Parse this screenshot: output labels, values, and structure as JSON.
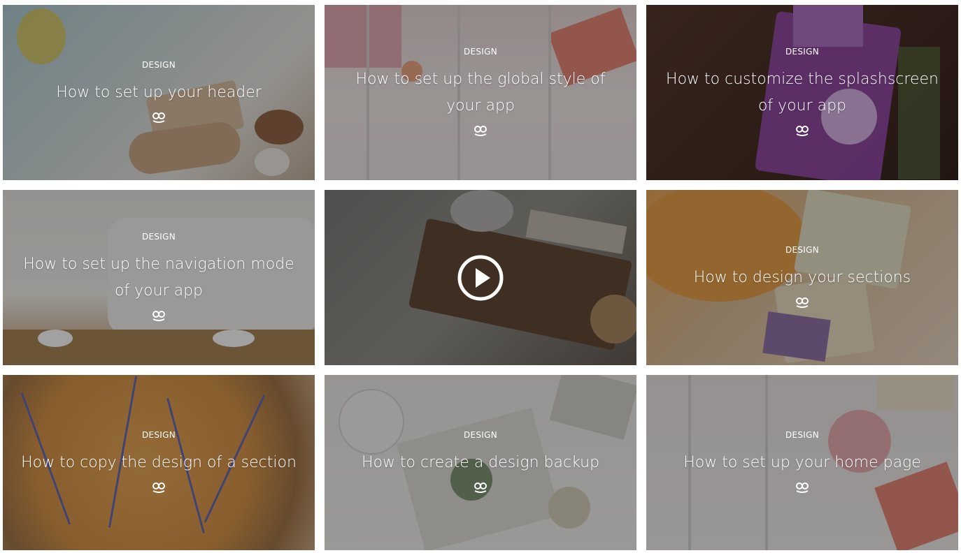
{
  "cards": [
    {
      "category": "DESIGN",
      "title": "How to set up your header",
      "logo_icon": "goodbarber-logo-icon",
      "bg": "#b9c7cc"
    },
    {
      "category": "DESIGN",
      "title": "How to set up the global style of your app",
      "logo_icon": "goodbarber-logo-icon",
      "bg": "#c7bfc0"
    },
    {
      "category": "DESIGN",
      "title": "How to customize the splashscreen of your app",
      "logo_icon": "goodbarber-logo-icon",
      "bg": "#3a2620"
    },
    {
      "category": "DESIGN",
      "title": "How to set up the navigation mode of your app",
      "logo_icon": "goodbarber-logo-icon",
      "bg": "#b5b1ae"
    },
    {
      "video": true,
      "play_icon": "play-button-icon",
      "bg": "#6e6e6a"
    },
    {
      "category": "DESIGN",
      "title": "How to design your sections",
      "logo_icon": "goodbarber-logo-icon",
      "bg": "#a48a6d"
    },
    {
      "category": "DESIGN",
      "title": "How to copy the design of a section",
      "logo_icon": "goodbarber-logo-icon",
      "bg": "#8a6a3e"
    },
    {
      "category": "DESIGN",
      "title": "How to create a design backup",
      "logo_icon": "goodbarber-logo-icon",
      "bg": "#b9bcb6"
    },
    {
      "category": "DESIGN",
      "title": "How to set up your home page",
      "logo_icon": "goodbarber-logo-icon",
      "bg": "#c9c2c2"
    }
  ]
}
